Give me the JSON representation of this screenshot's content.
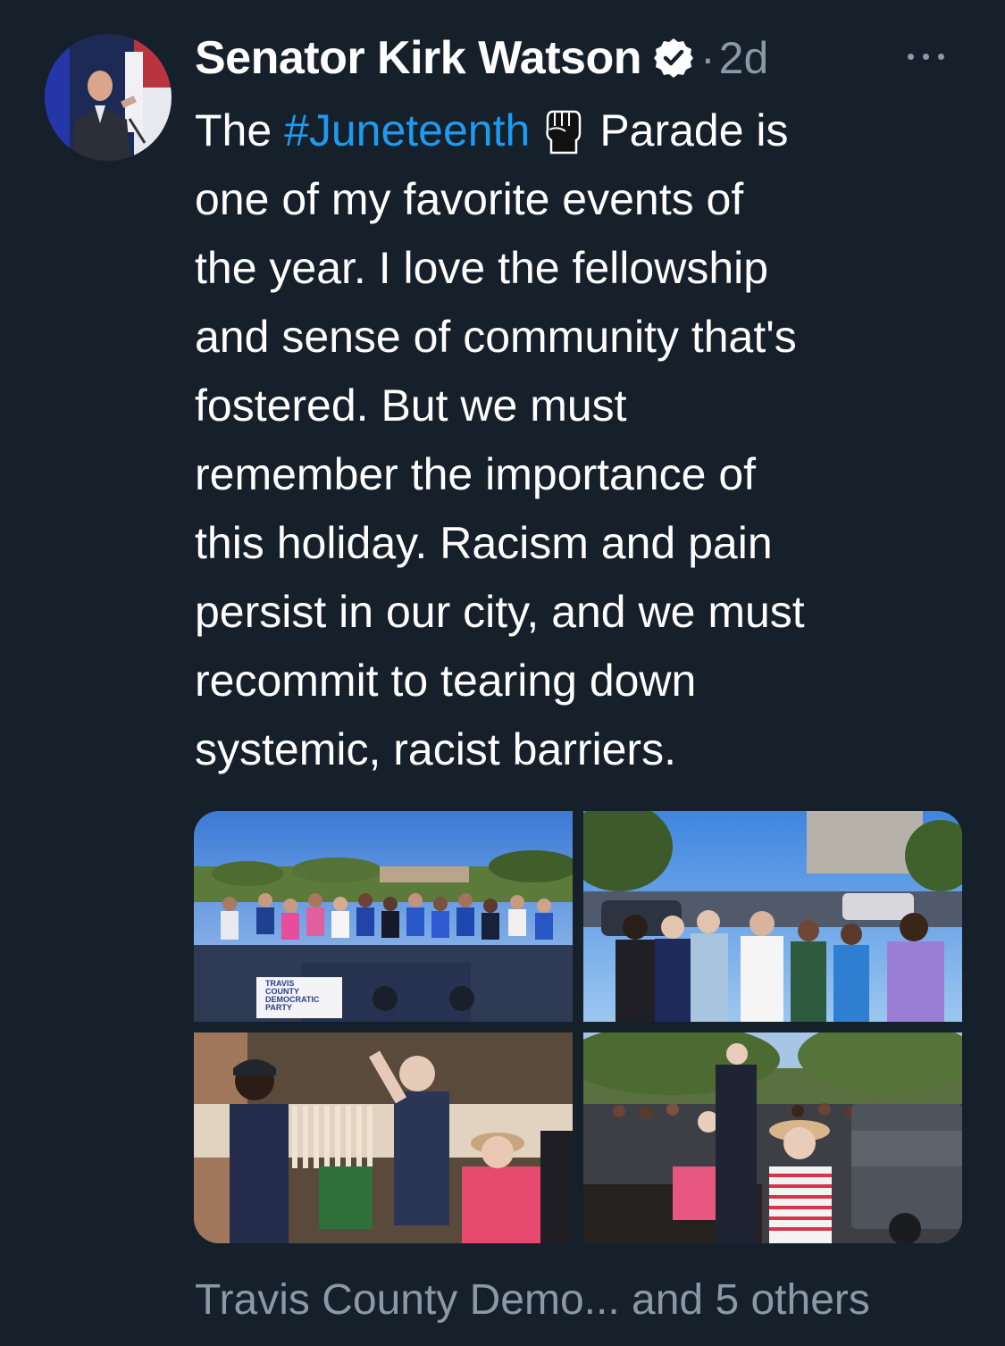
{
  "author": {
    "name": "Senator Kirk Watson",
    "verified_icon": "verified-badge-icon",
    "separator": "·",
    "time": "2d"
  },
  "more_icon": "more-options-icon",
  "tweet": {
    "line1_pre": "The ",
    "hashtag": "#Juneteenth",
    "emoji": "raised-fist-icon",
    "line1_post": "Parade is",
    "lines": [
      "one of my favorite events of",
      "the year. I love the fellowship",
      "and sense of community that's",
      "fostered. But we must",
      "remember the importance of",
      "this holiday. Racism and pain",
      "persist in our city, and we must",
      "recommit to tearing down",
      "systemic, racist barriers."
    ]
  },
  "media": {
    "photo1_banner": "TRAVIS COUNTY DEMOCRATIC PARTY",
    "photo1_banner_lines": [
      "TRAVIS",
      "COUNTY",
      "DEMOCRATIC",
      "PARTY"
    ]
  },
  "tagged_text": "Travis County Demo... and 5 others",
  "colors": {
    "background": "#15202b",
    "link": "#1d9bf0",
    "secondary_text": "#8b98a5"
  }
}
